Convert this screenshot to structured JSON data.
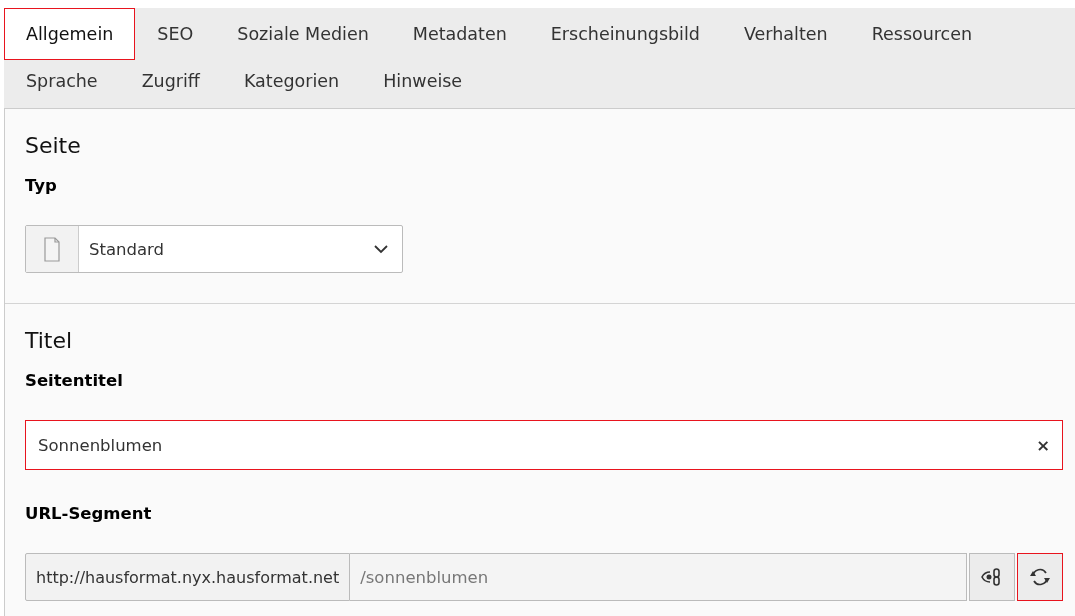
{
  "tab_rows": [
    [
      {
        "label": "Allgemein",
        "selected": true,
        "highlighted": true
      },
      {
        "label": "SEO",
        "selected": false,
        "highlighted": false
      },
      {
        "label": "Soziale Medien",
        "selected": false,
        "highlighted": false
      },
      {
        "label": "Metadaten",
        "selected": false,
        "highlighted": false
      },
      {
        "label": "Erscheinungsbild",
        "selected": false,
        "highlighted": false
      },
      {
        "label": "Verhalten",
        "selected": false,
        "highlighted": false
      },
      {
        "label": "Ressourcen",
        "selected": false,
        "highlighted": false
      }
    ],
    [
      {
        "label": "Sprache",
        "selected": false,
        "highlighted": false
      },
      {
        "label": "Zugriff",
        "selected": false,
        "highlighted": false
      },
      {
        "label": "Kategorien",
        "selected": false,
        "highlighted": false
      },
      {
        "label": "Hinweise",
        "selected": false,
        "highlighted": false
      }
    ]
  ],
  "sections": [
    {
      "title": "Seite",
      "fields": [
        {
          "kind": "select",
          "label": "Typ",
          "value": "Standard"
        }
      ]
    },
    {
      "title": "Titel",
      "fields": [
        {
          "kind": "text",
          "label": "Seitentitel",
          "value": "Sonnenblumen",
          "clear": "×",
          "highlighted": true
        },
        {
          "kind": "slug",
          "label": "URL-Segment",
          "prefix": "http://hausformat.nyx.hausformat.net",
          "value": "/sonnenblumen",
          "refresh_highlighted": true
        }
      ]
    }
  ]
}
